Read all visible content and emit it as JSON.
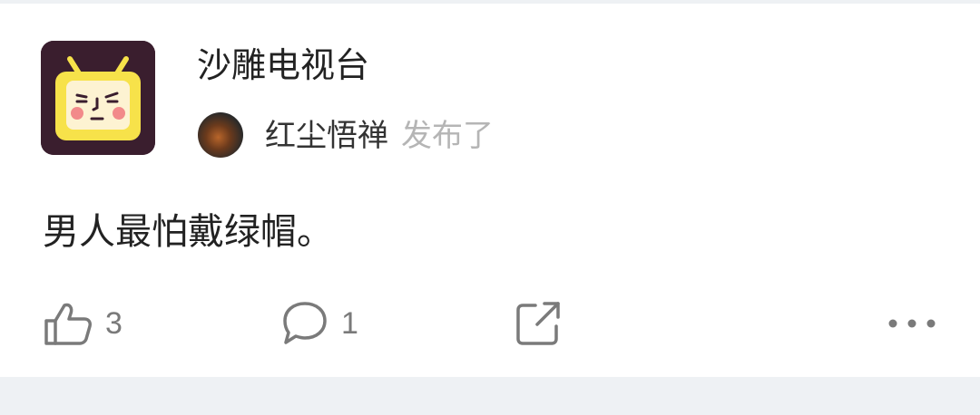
{
  "post": {
    "group_name": "沙雕电视台",
    "author_name": "红尘悟禅",
    "action_text": "发布了",
    "content": "男人最怕戴绿帽。"
  },
  "stats": {
    "likes": "3",
    "comments": "1"
  },
  "icons": {
    "like": "thumbs-up-icon",
    "comment": "speech-bubble-icon",
    "share": "share-icon",
    "more": "more-dots-icon"
  },
  "colors": {
    "group_avatar_bg": "#3a1e2e",
    "tv_face": "#f7e24a",
    "secondary_text": "#b5b5b5",
    "icon_gray": "#7a7a7a"
  }
}
